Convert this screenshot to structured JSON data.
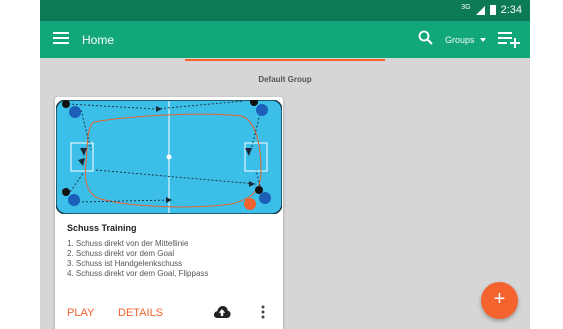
{
  "status_bar": {
    "network": "3G",
    "time": "2:34"
  },
  "app_bar": {
    "title": "Home",
    "groups_label": "Groups",
    "icons": [
      "menu-icon",
      "search-icon",
      "chevron-down-icon",
      "playlist-add-icon"
    ]
  },
  "group": {
    "title": "Default Group"
  },
  "card": {
    "title": "Schuss Training",
    "lines": [
      "1. Schuss direkt von der Mittellinie",
      "2. Schuss direkt vor dem Goal",
      "3. Schuss ist Handgelenkschuss",
      "4. Schuss direkt vor dem Goal, Flippass"
    ],
    "play_label": "PLAY",
    "details_label": "DETAILS",
    "icons": [
      "cloud-upload-icon",
      "more-vertical-icon"
    ]
  },
  "fab": {
    "label": "+"
  },
  "colors": {
    "status_bar": "#0b7a55",
    "app_bar": "#12a77a",
    "accent": "#f4622e",
    "field": "#3bbfe8",
    "player": "#1c5fb8"
  }
}
